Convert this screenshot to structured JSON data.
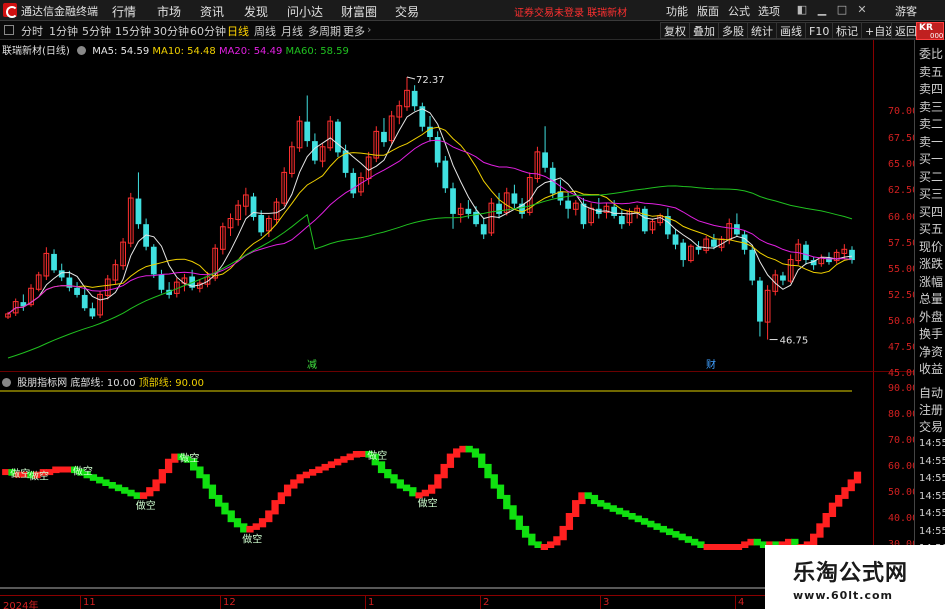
{
  "menubar": {
    "app_title": "通达信金融终端",
    "menus": [
      "行情",
      "市场",
      "资讯",
      "发现",
      "问小达",
      "财富圈",
      "交易"
    ],
    "notice": "证券交易未登录   联瑞新材",
    "right_menus": [
      "功能",
      "版面",
      "公式",
      "选项"
    ],
    "guest": "游客"
  },
  "periodbar": {
    "periods": [
      "分时",
      "1分钟",
      "5分钟",
      "15分钟",
      "30分钟",
      "60分钟",
      "日线",
      "周线",
      "月线",
      "多周期",
      "更多"
    ],
    "active_period": "日线",
    "tools": [
      "复权",
      "叠加",
      "多股",
      "统计",
      "画线",
      "F10",
      "标记",
      "+自选",
      "返回"
    ]
  },
  "main_panel": {
    "stock_title": "联瑞新材(日线)",
    "ma5_label": "MA5: 54.59",
    "ma10_label": "MA10: 54.48",
    "ma20_label": "MA20: 54.49",
    "ma60_label": "MA60: 58.59",
    "high_label": "72.37",
    "low_label": "46.75",
    "marker_jian": "减",
    "marker_cai": "财",
    "price_axis": [
      "70.00",
      "67.50",
      "65.00",
      "62.50",
      "60.00",
      "57.50",
      "55.00",
      "52.50",
      "50.00",
      "47.50",
      "45.00"
    ]
  },
  "sub_panel": {
    "indicator_name": "股朋指标网",
    "bottom_line_label": "底部线: 10.00",
    "top_line_label": "顶部线: 90.00",
    "axis": [
      "90.00",
      "80.00",
      "70.00",
      "60.00",
      "50.00",
      "40.00",
      "30.00"
    ],
    "signal_labels": [
      "做空",
      "做空",
      "做空",
      "做空",
      "做空",
      "做空",
      "做空",
      "做空"
    ]
  },
  "date_axis": [
    "2024年",
    "11",
    "12",
    "1",
    "2",
    "3",
    "4"
  ],
  "right_panel": {
    "badge": "KR",
    "badge_sub": "000",
    "items": [
      "委比",
      "卖五",
      "卖四",
      "卖三",
      "卖二",
      "卖一",
      "买一",
      "买二",
      "买三",
      "买四",
      "买五",
      "现价",
      "涨跌",
      "涨幅",
      "总量",
      "外盘",
      "换手",
      "净资",
      "收益"
    ],
    "lower_items": [
      "自动",
      "注册",
      "交易"
    ],
    "times": [
      "14:55",
      "14:55",
      "14:55",
      "14:55",
      "14:55",
      "14:55",
      "14:56",
      "14:56"
    ]
  },
  "chart_data": [
    {
      "type": "candlestick",
      "title": "联瑞新材(日线)",
      "ylim": [
        45.0,
        72.5
      ],
      "x": [
        "2024-10",
        "2024-11",
        "2024-12",
        "2025-01",
        "2025-02",
        "2025-03",
        "2025-04"
      ],
      "series": [
        {
          "name": "MA5",
          "value_last": 54.59
        },
        {
          "name": "MA10",
          "value_last": 54.48
        },
        {
          "name": "MA20",
          "value_last": 54.49
        },
        {
          "name": "MA60",
          "value_last": 58.59
        }
      ],
      "ohlc": [
        [
          49,
          49.5,
          48.8,
          49.3
        ],
        [
          49.4,
          50.8,
          49.1,
          50.5
        ],
        [
          50.4,
          51.2,
          49.6,
          50.1
        ],
        [
          50.2,
          52.2,
          50,
          51.8
        ],
        [
          51.7,
          53.4,
          51.5,
          53.1
        ],
        [
          53,
          55.8,
          52.6,
          55.2
        ],
        [
          55.1,
          55.6,
          53.3,
          53.6
        ],
        [
          53.5,
          54.2,
          52.5,
          52.9
        ],
        [
          52.8,
          53.5,
          51.5,
          51.9
        ],
        [
          51.8,
          52.4,
          50.9,
          51.2
        ],
        [
          51.1,
          51.8,
          49.6,
          49.9
        ],
        [
          49.8,
          50.4,
          48.8,
          49.1
        ],
        [
          49.2,
          51.5,
          48.9,
          51.2
        ],
        [
          51.1,
          53.1,
          50.7,
          52.7
        ],
        [
          52.6,
          54.6,
          52.2,
          54.1
        ],
        [
          54,
          56.7,
          53.6,
          56.3
        ],
        [
          56.2,
          61.1,
          55.8,
          60.6
        ],
        [
          60.5,
          63.1,
          57.6,
          58.1
        ],
        [
          58,
          58.6,
          55.5,
          55.9
        ],
        [
          55.8,
          56.1,
          52.8,
          53.2
        ],
        [
          53.1,
          53.6,
          51.3,
          51.7
        ],
        [
          51.6,
          52.4,
          50.8,
          51.2
        ],
        [
          51.3,
          52.8,
          50.9,
          52.4
        ],
        [
          52.3,
          53.2,
          51.5,
          52.8
        ],
        [
          52.9,
          53.6,
          51.6,
          51.9
        ],
        [
          51.8,
          52.7,
          51.4,
          52.3
        ],
        [
          52.2,
          53.4,
          51.9,
          52.9
        ],
        [
          52.8,
          56.1,
          52.5,
          55.7
        ],
        [
          55.6,
          58.2,
          55.1,
          57.8
        ],
        [
          57.7,
          59.1,
          56.9,
          58.6
        ],
        [
          58.5,
          60.4,
          57.9,
          59.9
        ],
        [
          59.8,
          61.6,
          58.9,
          60.9
        ],
        [
          60.7,
          61.1,
          58.4,
          58.8
        ],
        [
          58.9,
          59.4,
          56.9,
          57.3
        ],
        [
          57.4,
          58.9,
          56.8,
          58.6
        ],
        [
          58.5,
          60.6,
          58.1,
          60.2
        ],
        [
          60.1,
          63.6,
          59.8,
          63.1
        ],
        [
          63,
          66.1,
          62.6,
          65.6
        ],
        [
          65.5,
          68.6,
          65.1,
          68.1
        ],
        [
          68,
          70.6,
          65.6,
          66.2
        ],
        [
          66.1,
          66.9,
          63.9,
          64.3
        ],
        [
          64.2,
          65.9,
          63.6,
          65.6
        ],
        [
          65.5,
          68.6,
          65.2,
          68.1
        ],
        [
          68,
          68.3,
          64.6,
          65.1
        ],
        [
          65.2,
          65.8,
          62.6,
          63.1
        ],
        [
          63,
          63.5,
          60.6,
          61.1
        ],
        [
          61.2,
          63.1,
          60.8,
          62.6
        ],
        [
          62.5,
          65.1,
          61.9,
          64.6
        ],
        [
          64.5,
          67.6,
          64.1,
          67.1
        ],
        [
          67,
          68.4,
          65.6,
          66.1
        ],
        [
          66.2,
          69.1,
          65.9,
          68.6
        ],
        [
          68.5,
          70.1,
          67.8,
          69.6
        ],
        [
          69.5,
          72.4,
          69.1,
          71.1
        ],
        [
          71,
          71.6,
          69.1,
          69.6
        ],
        [
          69.5,
          69.9,
          67.1,
          67.6
        ],
        [
          67.5,
          68.6,
          66.1,
          66.6
        ],
        [
          66.5,
          67.1,
          63.6,
          64.1
        ],
        [
          64.2,
          64.7,
          61.1,
          61.6
        ],
        [
          61.5,
          62.1,
          57.6,
          59.1
        ],
        [
          59,
          60.1,
          58.2,
          59.6
        ],
        [
          59.5,
          60.4,
          58.6,
          59.1
        ],
        [
          59.2,
          59.8,
          57.8,
          58.1
        ],
        [
          58,
          58.6,
          56.6,
          57.1
        ],
        [
          57.2,
          60.6,
          56.9,
          60.1
        ],
        [
          60,
          61.1,
          58.6,
          59.1
        ],
        [
          59.2,
          61.6,
          58.9,
          61.1
        ],
        [
          61,
          61.9,
          59.6,
          60.1
        ],
        [
          60,
          60.6,
          58.6,
          59.1
        ],
        [
          59.2,
          63.1,
          58.9,
          62.6
        ],
        [
          62.5,
          65.6,
          62.1,
          65.1
        ],
        [
          65,
          67.6,
          63.1,
          63.6
        ],
        [
          63.5,
          64.1,
          60.6,
          61.1
        ],
        [
          61.2,
          62.4,
          59.9,
          60.4
        ],
        [
          60.3,
          61.1,
          58.6,
          59.6
        ],
        [
          59.5,
          60.4,
          58.9,
          60.1
        ],
        [
          60,
          60.6,
          57.6,
          58.1
        ],
        [
          58.2,
          60.1,
          57.9,
          59.6
        ],
        [
          59.5,
          60.6,
          58.6,
          59.1
        ],
        [
          59.2,
          60.1,
          58.6,
          59.8
        ],
        [
          59.7,
          60.4,
          58.6,
          58.9
        ],
        [
          58.8,
          59.4,
          57.6,
          58.1
        ],
        [
          58.2,
          59.6,
          57.9,
          59.3
        ],
        [
          59.2,
          59.9,
          58.6,
          59.6
        ],
        [
          59.5,
          59.8,
          57.1,
          57.4
        ],
        [
          57.5,
          58.6,
          57.1,
          58.3
        ],
        [
          58.2,
          59.1,
          57.9,
          58.9
        ],
        [
          58.8,
          59.6,
          56.6,
          57.1
        ],
        [
          57,
          57.6,
          55.6,
          56.1
        ],
        [
          56.2,
          56.6,
          53.9,
          54.6
        ],
        [
          54.5,
          56.1,
          54.3,
          55.9
        ],
        [
          55.8,
          56.4,
          55.1,
          55.6
        ],
        [
          55.5,
          56.9,
          55.2,
          56.6
        ],
        [
          56.5,
          57.1,
          55.6,
          55.9
        ],
        [
          55.8,
          56.9,
          55.4,
          56.6
        ],
        [
          56.5,
          58.6,
          56.1,
          58.1
        ],
        [
          58,
          59.1,
          56.9,
          57.1
        ],
        [
          57,
          57.4,
          55.1,
          55.6
        ],
        [
          55.5,
          55.9,
          52.1,
          52.6
        ],
        [
          52.5,
          52.9,
          47.1,
          48.6
        ],
        [
          48.5,
          52.1,
          46.8,
          51.6
        ],
        [
          51.5,
          53.6,
          51.1,
          53.1
        ],
        [
          53,
          53.4,
          52.1,
          52.6
        ],
        [
          52.5,
          55.1,
          52.3,
          54.6
        ],
        [
          54.5,
          56.6,
          54.1,
          56.1
        ],
        [
          56,
          56.4,
          54.1,
          54.6
        ],
        [
          54.5,
          54.9,
          53.6,
          54.1
        ],
        [
          54.2,
          55.1,
          53.9,
          54.8
        ],
        [
          54.7,
          55.3,
          54.1,
          54.4
        ],
        [
          54.5,
          55.6,
          54.2,
          55.3
        ],
        [
          55.2,
          56.1,
          54.6,
          55.6
        ],
        [
          55.5,
          55.9,
          54.2,
          54.6
        ]
      ]
    },
    {
      "type": "line",
      "title": "股朋指标网",
      "ylim": [
        20,
        100
      ],
      "series": [
        {
          "name": "底部线",
          "values": [
            10
          ]
        },
        {
          "name": "顶部线",
          "values": [
            90
          ]
        }
      ],
      "osc": [
        59,
        59,
        58,
        58,
        58,
        57,
        58,
        59,
        59,
        60,
        60,
        60,
        59,
        58,
        57,
        56,
        55,
        54,
        53,
        52,
        51,
        50,
        49,
        50,
        52,
        55,
        59,
        63,
        65,
        64,
        63,
        60,
        57,
        53,
        49,
        46,
        43,
        40,
        38,
        36,
        37,
        38,
        40,
        43,
        47,
        50,
        53,
        55,
        57,
        58,
        59,
        60,
        61,
        62,
        63,
        64,
        65,
        66,
        66,
        65,
        62,
        59,
        57,
        55,
        53,
        52,
        50,
        50,
        51,
        53,
        57,
        61,
        65,
        67,
        68,
        67,
        65,
        61,
        57,
        53,
        49,
        45,
        41,
        37,
        34,
        31,
        30,
        30,
        31,
        33,
        37,
        42,
        47,
        50,
        49,
        47,
        46,
        45,
        44,
        43,
        42,
        41,
        40,
        39,
        38,
        37,
        36,
        35,
        34,
        33,
        32,
        31,
        30,
        30,
        30,
        30,
        30,
        30,
        30,
        31,
        32,
        31,
        30,
        31,
        30,
        31,
        32,
        30,
        30,
        31,
        34,
        38,
        42,
        46,
        49,
        52,
        55,
        58
      ]
    }
  ]
}
